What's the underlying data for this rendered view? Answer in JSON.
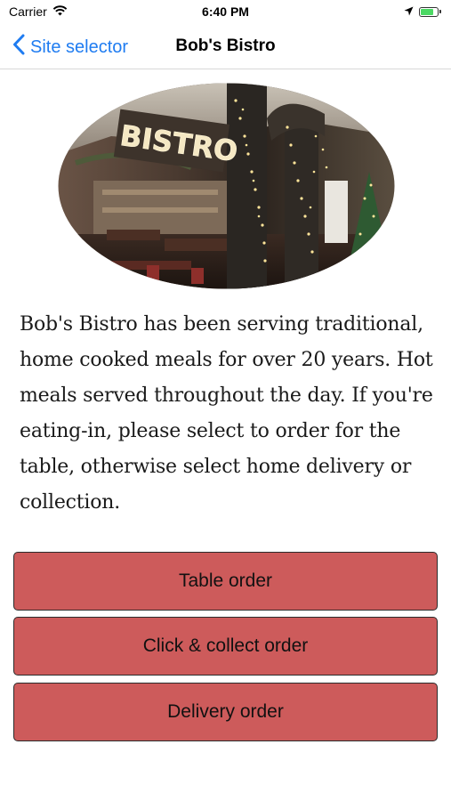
{
  "status_bar": {
    "carrier": "Carrier",
    "time": "6:40 PM",
    "battery_level": 0.85,
    "battery_color": "#4cd964"
  },
  "nav": {
    "back_label": "Site selector",
    "title": "Bob's Bistro",
    "accent_color": "#1f7cf1"
  },
  "hero": {
    "sign_text": "BISTRO"
  },
  "description": "Bob's Bistro has been serving traditional, home cooked meals for over 20 years. Hot meals served throughout the day. If you're eating-in, please select to order for the table, otherwise select home delivery or collection.",
  "buttons": {
    "color": "#cd5b5b",
    "items": [
      {
        "label": "Table order"
      },
      {
        "label": "Click & collect order"
      },
      {
        "label": "Delivery order"
      }
    ]
  }
}
